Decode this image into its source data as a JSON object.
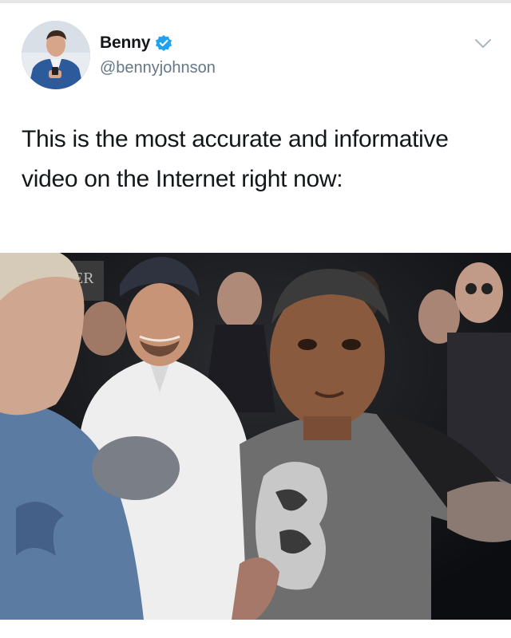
{
  "tweet": {
    "display_name": "Benny",
    "handle": "@bennyjohnson",
    "verified": true,
    "text": "This is the most accurate and informative video on the Internet right now:"
  },
  "icons": {
    "avatar": "profile-photo",
    "verified": "verified-badge-icon",
    "menu": "chevron-down-icon"
  },
  "colors": {
    "name": "#14171a",
    "handle": "#657786",
    "verified": "#1da1f2",
    "chevron": "#aab8c2"
  },
  "media": {
    "type": "video-still",
    "overlay_text": "ER"
  }
}
